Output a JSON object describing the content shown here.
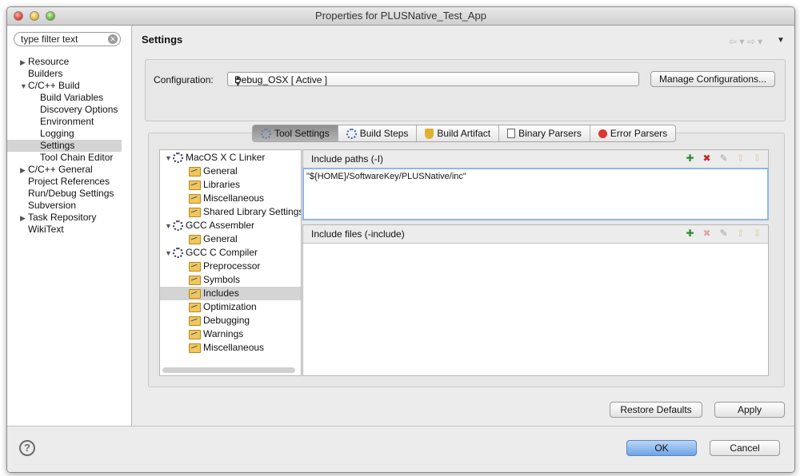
{
  "window": {
    "title": "Properties for PLUSNative_Test_App"
  },
  "filter": {
    "placeholder": "type filter text"
  },
  "nav": [
    {
      "label": "Resource",
      "expand": "▶",
      "indent": 0
    },
    {
      "label": "Builders",
      "expand": "",
      "indent": 0
    },
    {
      "label": "C/C++ Build",
      "expand": "▼",
      "indent": 0
    },
    {
      "label": "Build Variables",
      "expand": "",
      "indent": 1
    },
    {
      "label": "Discovery Options",
      "expand": "",
      "indent": 1
    },
    {
      "label": "Environment",
      "expand": "",
      "indent": 1
    },
    {
      "label": "Logging",
      "expand": "",
      "indent": 1
    },
    {
      "label": "Settings",
      "expand": "",
      "indent": 1,
      "selected": true
    },
    {
      "label": "Tool Chain Editor",
      "expand": "",
      "indent": 1
    },
    {
      "label": "C/C++ General",
      "expand": "▶",
      "indent": 0
    },
    {
      "label": "Project References",
      "expand": "",
      "indent": 0
    },
    {
      "label": "Run/Debug Settings",
      "expand": "",
      "indent": 0
    },
    {
      "label": "Subversion",
      "expand": "",
      "indent": 0
    },
    {
      "label": "Task Repository",
      "expand": "▶",
      "indent": 0
    },
    {
      "label": "WikiText",
      "expand": "",
      "indent": 0
    }
  ],
  "page": {
    "title": "Settings"
  },
  "config": {
    "label": "Configuration:",
    "value": "Debug_OSX  [ Active ]",
    "manage_label": "Manage Configurations..."
  },
  "tabs": [
    {
      "label": "Tool Settings",
      "icon": "tool-settings-icon",
      "active": true
    },
    {
      "label": "Build Steps",
      "icon": "build-steps-icon"
    },
    {
      "label": "Build Artifact",
      "icon": "trophy-icon"
    },
    {
      "label": "Binary Parsers",
      "icon": "binary-icon"
    },
    {
      "label": "Error Parsers",
      "icon": "error-icon"
    }
  ],
  "tree": [
    {
      "label": "MacOS X C Linker",
      "type": "tool",
      "expand": "▼"
    },
    {
      "label": "General",
      "type": "option"
    },
    {
      "label": "Libraries",
      "type": "option"
    },
    {
      "label": "Miscellaneous",
      "type": "option"
    },
    {
      "label": "Shared Library Settings",
      "type": "option"
    },
    {
      "label": "GCC Assembler",
      "type": "tool",
      "expand": "▼"
    },
    {
      "label": "General",
      "type": "option"
    },
    {
      "label": "GCC C Compiler",
      "type": "tool",
      "expand": "▼"
    },
    {
      "label": "Preprocessor",
      "type": "option"
    },
    {
      "label": "Symbols",
      "type": "option"
    },
    {
      "label": "Includes",
      "type": "option",
      "selected": true
    },
    {
      "label": "Optimization",
      "type": "option"
    },
    {
      "label": "Debugging",
      "type": "option"
    },
    {
      "label": "Warnings",
      "type": "option"
    },
    {
      "label": "Miscellaneous",
      "type": "option"
    }
  ],
  "include_paths": {
    "title": "Include paths (-I)",
    "items": [
      "\"${HOME}/SoftwareKey/PLUSNative/inc\""
    ]
  },
  "include_files": {
    "title": "Include files (-include)",
    "items": []
  },
  "buttons": {
    "restore": "Restore Defaults",
    "apply": "Apply",
    "ok": "OK",
    "cancel": "Cancel",
    "help": "?"
  }
}
